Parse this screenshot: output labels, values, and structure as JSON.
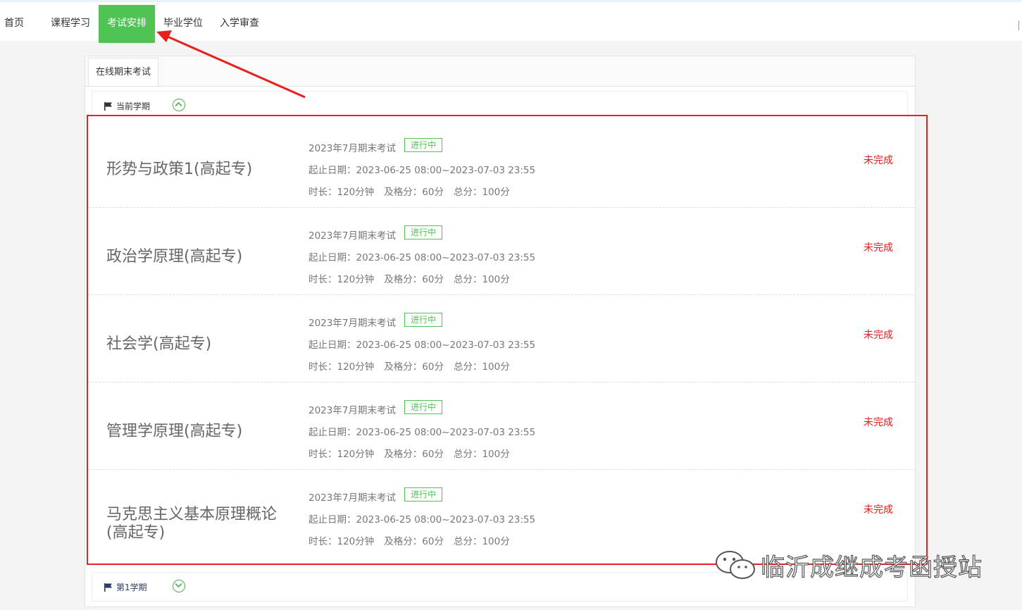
{
  "nav": {
    "items": [
      {
        "label": "首页",
        "active": false
      },
      {
        "label": "课程学习",
        "active": false
      },
      {
        "label": "考试安排",
        "active": true
      },
      {
        "label": "毕业学位",
        "active": false
      },
      {
        "label": "入学审查",
        "active": false
      }
    ]
  },
  "tabs": [
    {
      "label": "在线期末考试",
      "active": true
    }
  ],
  "terms": {
    "current_label": "当前学期",
    "next_label": "第1学期"
  },
  "exams": [
    {
      "name": "形势与政策1(高起专)",
      "exam": "2023年7月期末考试",
      "badge": "进行中",
      "date_label": "起止日期：",
      "date": "2023-06-25 08:00~2023-07-03 23:55",
      "duration": "时长：120分钟",
      "pass": "及格分：60分",
      "total": "总分：100分",
      "status": "未完成"
    },
    {
      "name": "政治学原理(高起专)",
      "exam": "2023年7月期末考试",
      "badge": "进行中",
      "date_label": "起止日期：",
      "date": "2023-06-25 08:00~2023-07-03 23:55",
      "duration": "时长：120分钟",
      "pass": "及格分：60分",
      "total": "总分：100分",
      "status": "未完成"
    },
    {
      "name": "社会学(高起专)",
      "exam": "2023年7月期末考试",
      "badge": "进行中",
      "date_label": "起止日期：",
      "date": "2023-06-25 08:00~2023-07-03 23:55",
      "duration": "时长：120分钟",
      "pass": "及格分：60分",
      "total": "总分：100分",
      "status": "未完成"
    },
    {
      "name": "管理学原理(高起专)",
      "exam": "2023年7月期末考试",
      "badge": "进行中",
      "date_label": "起止日期：",
      "date": "2023-06-25 08:00~2023-07-03 23:55",
      "duration": "时长：120分钟",
      "pass": "及格分：60分",
      "total": "总分：100分",
      "status": "未完成"
    },
    {
      "name": "马克思主义基本原理概论(高起专)",
      "exam": "2023年7月期末考试",
      "badge": "进行中",
      "date_label": "起止日期：",
      "date": "2023-06-25 08:00~2023-07-03 23:55",
      "duration": "时长：120分钟",
      "pass": "及格分：60分",
      "total": "总分：100分",
      "status": "未完成"
    }
  ],
  "watermark": {
    "text": "临沂成继成考函授站",
    "icon": "wechat-icon"
  },
  "colors": {
    "active_nav": "#4fc455",
    "badge": "#4fc455",
    "status": "#e02020",
    "annotation": "#e8201e"
  }
}
